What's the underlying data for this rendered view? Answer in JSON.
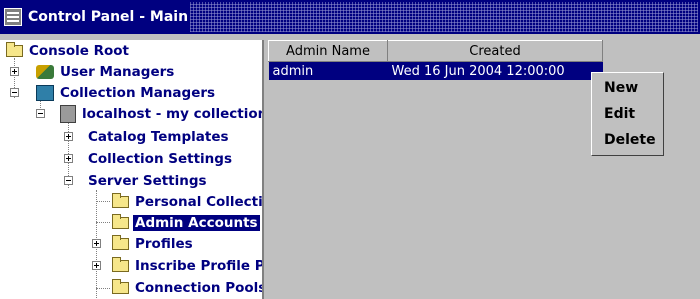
{
  "window": {
    "title": "Control Panel - Main"
  },
  "tree": {
    "root": "Console Root",
    "user_managers": "User Managers",
    "collection_managers": "Collection Managers",
    "localhost": "localhost - my collection",
    "catalog_templates": "Catalog Templates",
    "collection_settings": "Collection Settings",
    "server_settings": "Server Settings",
    "personal_collections": "Personal Collecti",
    "admin_accounts": "Admin Accounts",
    "profiles": "Profiles",
    "inscribe_profile": "Inscribe Profile P",
    "connection_pools": "Connection Pools"
  },
  "table": {
    "headers": [
      "Admin Name",
      "Created"
    ],
    "rows": [
      [
        "admin",
        "Wed 16 Jun 2004 12:00:00"
      ]
    ]
  },
  "context_menu": {
    "items": [
      "New",
      "Edit",
      "Delete"
    ]
  }
}
